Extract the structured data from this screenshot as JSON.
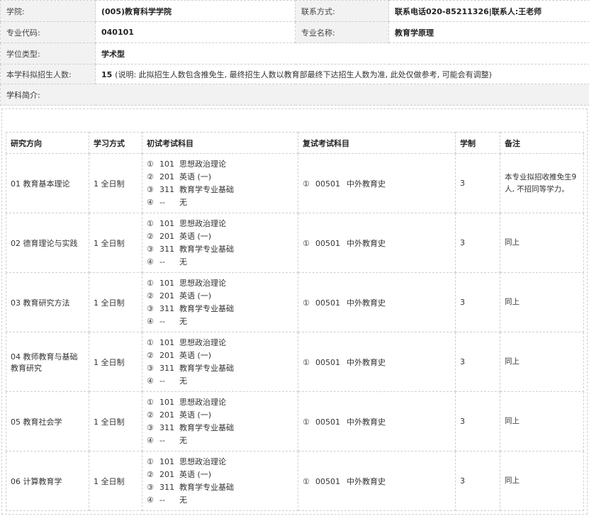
{
  "info": {
    "college_label": "学院:",
    "college_value": "(005)教育科学学院",
    "contact_label": "联系方式:",
    "contact_value": "联系电话020-85211326|联系人:王老师",
    "major_code_label": "专业代码:",
    "major_code_value": "040101",
    "major_name_label": "专业名称:",
    "major_name_value": "教育学原理",
    "degree_type_label": "学位类型:",
    "degree_type_value": "学术型",
    "enroll_label": "本学科拟招生人数:",
    "enroll_value": "15",
    "enroll_note": "(说明: 此拟招生人数包含推免生, 最终招生人数以教育部最终下达招生人数为准, 此处仅做参考, 可能会有调整)",
    "intro_label": "学科简介:"
  },
  "table": {
    "headers": [
      "研究方向",
      "学习方式",
      "初试考试科目",
      "复试考试科目",
      "学制",
      "备注"
    ],
    "rows": [
      {
        "direction": "01 教育基本理论",
        "mode": "1 全日制",
        "subjects": [
          {
            "circle": "①",
            "code": "101",
            "name": "思想政治理论"
          },
          {
            "circle": "②",
            "code": "201",
            "name": "英语 (一)"
          },
          {
            "circle": "③",
            "code": "311",
            "name": "教育学专业基础"
          },
          {
            "circle": "④",
            "code": "--",
            "name": "无"
          }
        ],
        "retest": {
          "circle": "①",
          "code": "00501",
          "name": "中外教育史"
        },
        "years": "3",
        "remark": "本专业拟招收推免生9人, 不招同等学力。"
      },
      {
        "direction": "02 德育理论与实践",
        "mode": "1 全日制",
        "subjects": [
          {
            "circle": "①",
            "code": "101",
            "name": "思想政治理论"
          },
          {
            "circle": "②",
            "code": "201",
            "name": "英语 (一)"
          },
          {
            "circle": "③",
            "code": "311",
            "name": "教育学专业基础"
          },
          {
            "circle": "④",
            "code": "--",
            "name": "无"
          }
        ],
        "retest": {
          "circle": "①",
          "code": "00501",
          "name": "中外教育史"
        },
        "years": "3",
        "remark": "同上"
      },
      {
        "direction": "03 教育研究方法",
        "mode": "1 全日制",
        "subjects": [
          {
            "circle": "①",
            "code": "101",
            "name": "思想政治理论"
          },
          {
            "circle": "②",
            "code": "201",
            "name": "英语 (一)"
          },
          {
            "circle": "③",
            "code": "311",
            "name": "教育学专业基础"
          },
          {
            "circle": "④",
            "code": "--",
            "name": "无"
          }
        ],
        "retest": {
          "circle": "①",
          "code": "00501",
          "name": "中外教育史"
        },
        "years": "3",
        "remark": "同上"
      },
      {
        "direction": "04 教师教育与基础教育研究",
        "mode": "1 全日制",
        "subjects": [
          {
            "circle": "①",
            "code": "101",
            "name": "思想政治理论"
          },
          {
            "circle": "②",
            "code": "201",
            "name": "英语 (一)"
          },
          {
            "circle": "③",
            "code": "311",
            "name": "教育学专业基础"
          },
          {
            "circle": "④",
            "code": "--",
            "name": "无"
          }
        ],
        "retest": {
          "circle": "①",
          "code": "00501",
          "name": "中外教育史"
        },
        "years": "3",
        "remark": "同上"
      },
      {
        "direction": "05 教育社会学",
        "mode": "1 全日制",
        "subjects": [
          {
            "circle": "①",
            "code": "101",
            "name": "思想政治理论"
          },
          {
            "circle": "②",
            "code": "201",
            "name": "英语 (一)"
          },
          {
            "circle": "③",
            "code": "311",
            "name": "教育学专业基础"
          },
          {
            "circle": "④",
            "code": "--",
            "name": "无"
          }
        ],
        "retest": {
          "circle": "①",
          "code": "00501",
          "name": "中外教育史"
        },
        "years": "3",
        "remark": "同上"
      },
      {
        "direction": "06 计算教育学",
        "mode": "1 全日制",
        "subjects": [
          {
            "circle": "①",
            "code": "101",
            "name": "思想政治理论"
          },
          {
            "circle": "②",
            "code": "201",
            "name": "英语 (一)"
          },
          {
            "circle": "③",
            "code": "311",
            "name": "教育学专业基础"
          },
          {
            "circle": "④",
            "code": "--",
            "name": "无"
          }
        ],
        "retest": {
          "circle": "①",
          "code": "00501",
          "name": "中外教育史"
        },
        "years": "3",
        "remark": "同上"
      }
    ]
  }
}
